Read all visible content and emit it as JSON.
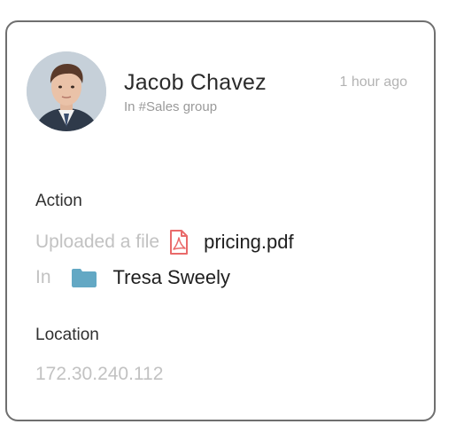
{
  "user": {
    "name": "Jacob Chavez",
    "group": "In #Sales group",
    "time": "1 hour ago",
    "avatar_icon": "user-photo"
  },
  "action": {
    "label": "Action",
    "verb": "Uploaded a file",
    "file_icon": "pdf-file-icon",
    "file_name": "pricing.pdf",
    "in_label": "In",
    "folder_icon": "folder-icon",
    "folder_name": "Tresa Sweely"
  },
  "location": {
    "label": "Location",
    "ip": "172.30.240.112"
  },
  "colors": {
    "pdf_icon": "#e96a6a",
    "folder_icon": "#63a8c4",
    "border": "#6f6f6f"
  }
}
